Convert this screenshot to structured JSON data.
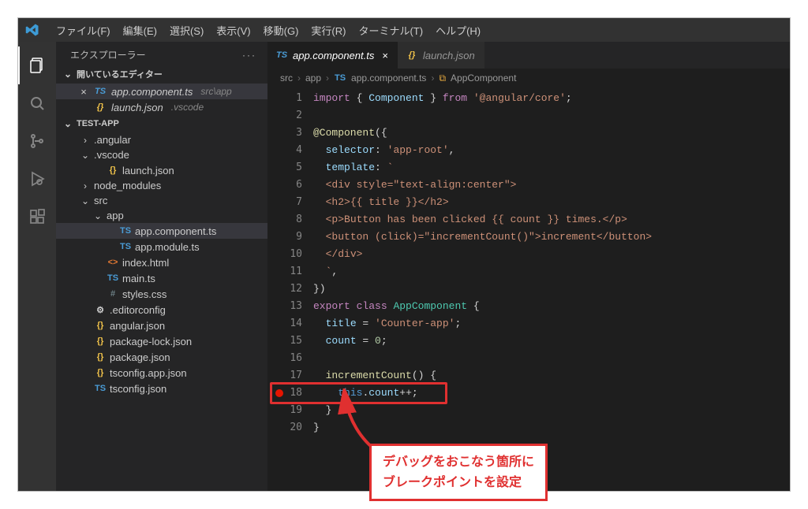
{
  "menubar": {
    "items": [
      "ファイル(F)",
      "編集(E)",
      "選択(S)",
      "表示(V)",
      "移動(G)",
      "実行(R)",
      "ターミナル(T)",
      "ヘルプ(H)"
    ]
  },
  "sidebar": {
    "title": "エクスプローラー",
    "open_editors_label": "開いているエディター",
    "open_editors": [
      {
        "name": "app.component.ts",
        "icon": "TS",
        "path": "src\\app",
        "active": true,
        "close": true
      },
      {
        "name": "launch.json",
        "icon": "{}",
        "path": ".vscode",
        "active": false,
        "close": false
      }
    ],
    "project": "TEST-APP",
    "tree": [
      {
        "type": "folder",
        "name": ".angular",
        "expanded": false,
        "indent": 1
      },
      {
        "type": "folder",
        "name": ".vscode",
        "expanded": true,
        "indent": 1
      },
      {
        "type": "file",
        "name": "launch.json",
        "icon": "{}",
        "iconClass": "icon-json",
        "indent": 2
      },
      {
        "type": "folder",
        "name": "node_modules",
        "expanded": false,
        "indent": 1
      },
      {
        "type": "folder",
        "name": "src",
        "expanded": true,
        "indent": 1
      },
      {
        "type": "folder",
        "name": "app",
        "expanded": true,
        "indent": 2
      },
      {
        "type": "file",
        "name": "app.component.ts",
        "icon": "TS",
        "iconClass": "icon-ts",
        "indent": 3,
        "selected": true
      },
      {
        "type": "file",
        "name": "app.module.ts",
        "icon": "TS",
        "iconClass": "icon-ts",
        "indent": 3
      },
      {
        "type": "file",
        "name": "index.html",
        "icon": "<>",
        "iconClass": "icon-html",
        "indent": 2
      },
      {
        "type": "file",
        "name": "main.ts",
        "icon": "TS",
        "iconClass": "icon-ts",
        "indent": 2
      },
      {
        "type": "file",
        "name": "styles.css",
        "icon": "#",
        "iconClass": "icon-css",
        "indent": 2
      },
      {
        "type": "file",
        "name": ".editorconfig",
        "icon": "⚙",
        "iconClass": "",
        "indent": 1
      },
      {
        "type": "file",
        "name": "angular.json",
        "icon": "{}",
        "iconClass": "icon-json",
        "indent": 1
      },
      {
        "type": "file",
        "name": "package-lock.json",
        "icon": "{}",
        "iconClass": "icon-json",
        "indent": 1
      },
      {
        "type": "file",
        "name": "package.json",
        "icon": "{}",
        "iconClass": "icon-json",
        "indent": 1
      },
      {
        "type": "file",
        "name": "tsconfig.app.json",
        "icon": "{}",
        "iconClass": "icon-json",
        "indent": 1
      },
      {
        "type": "file",
        "name": "tsconfig.json",
        "icon": "TS",
        "iconClass": "icon-ts",
        "indent": 1
      }
    ]
  },
  "tabs": [
    {
      "name": "app.component.ts",
      "icon": "TS",
      "active": true,
      "close": true
    },
    {
      "name": "launch.json",
      "icon": "{}",
      "active": false,
      "close": false
    }
  ],
  "breadcrumbs": {
    "parts": [
      "src",
      "app",
      "app.component.ts",
      "AppComponent"
    ],
    "file_icon": "TS",
    "struct_icon": "struct"
  },
  "code": {
    "lines": [
      1,
      2,
      3,
      4,
      5,
      6,
      7,
      8,
      9,
      10,
      11,
      12,
      13,
      14,
      15,
      16,
      17,
      18,
      19,
      20
    ],
    "breakpoint_line": 18,
    "content": {
      "l1": {
        "pre": "",
        "tokens": [
          [
            "tk-kw",
            "import"
          ],
          [
            "tk-punc",
            " { "
          ],
          [
            "tk-var",
            "Component"
          ],
          [
            "tk-punc",
            " } "
          ],
          [
            "tk-kw",
            "from"
          ],
          [
            "tk-punc",
            " "
          ],
          [
            "tk-str",
            "'@angular/core'"
          ],
          [
            "tk-punc",
            ";"
          ]
        ]
      },
      "l2": {
        "pre": "",
        "tokens": []
      },
      "l3": {
        "pre": "",
        "tokens": [
          [
            "tk-dec",
            "@Component"
          ],
          [
            "tk-punc",
            "({"
          ]
        ]
      },
      "l4": {
        "pre": "  ",
        "tokens": [
          [
            "tk-attr",
            "selector"
          ],
          [
            "tk-punc",
            ": "
          ],
          [
            "tk-str",
            "'app-root'"
          ],
          [
            "tk-punc",
            ","
          ]
        ]
      },
      "l5": {
        "pre": "  ",
        "tokens": [
          [
            "tk-attr",
            "template"
          ],
          [
            "tk-punc",
            ": "
          ],
          [
            "tk-str",
            "`"
          ]
        ]
      },
      "l6": {
        "pre": "  ",
        "tokens": [
          [
            "tk-str",
            "<div style=\"text-align:center\">"
          ]
        ]
      },
      "l7": {
        "pre": "  ",
        "tokens": [
          [
            "tk-str",
            "<h2>{{ title }}</h2>"
          ]
        ]
      },
      "l8": {
        "pre": "  ",
        "tokens": [
          [
            "tk-str",
            "<p>Button has been clicked {{ count }} times.</p>"
          ]
        ]
      },
      "l9": {
        "pre": "  ",
        "tokens": [
          [
            "tk-str",
            "<button (click)=\"incrementCount()\">increment</button>"
          ]
        ]
      },
      "l10": {
        "pre": "  ",
        "tokens": [
          [
            "tk-str",
            "</div>"
          ]
        ]
      },
      "l11": {
        "pre": "  ",
        "tokens": [
          [
            "tk-str",
            "`"
          ],
          [
            "tk-punc",
            ","
          ]
        ]
      },
      "l12": {
        "pre": "",
        "tokens": [
          [
            "tk-punc",
            "})"
          ]
        ]
      },
      "l13": {
        "pre": "",
        "tokens": [
          [
            "tk-kw",
            "export"
          ],
          [
            "tk-punc",
            " "
          ],
          [
            "tk-kw",
            "class"
          ],
          [
            "tk-punc",
            " "
          ],
          [
            "tk-type",
            "AppComponent"
          ],
          [
            "tk-punc",
            " {"
          ]
        ]
      },
      "l14": {
        "pre": "  ",
        "tokens": [
          [
            "tk-attr",
            "title"
          ],
          [
            "tk-punc",
            " = "
          ],
          [
            "tk-str",
            "'Counter-app'"
          ],
          [
            "tk-punc",
            ";"
          ]
        ]
      },
      "l15": {
        "pre": "  ",
        "tokens": [
          [
            "tk-attr",
            "count"
          ],
          [
            "tk-punc",
            " = "
          ],
          [
            "tk-num",
            "0"
          ],
          [
            "tk-punc",
            ";"
          ]
        ]
      },
      "l16": {
        "pre": "",
        "tokens": []
      },
      "l17": {
        "pre": "  ",
        "tokens": [
          [
            "tk-dec",
            "incrementCount"
          ],
          [
            "tk-punc",
            "() {"
          ]
        ]
      },
      "l18": {
        "pre": "    ",
        "tokens": [
          [
            "tk-id",
            "this"
          ],
          [
            "tk-punc",
            "."
          ],
          [
            "tk-attr",
            "count"
          ],
          [
            "tk-punc",
            "++;"
          ]
        ]
      },
      "l19": {
        "pre": "  ",
        "tokens": [
          [
            "tk-punc",
            "}"
          ]
        ]
      },
      "l20": {
        "pre": "",
        "tokens": [
          [
            "tk-punc",
            "}"
          ]
        ]
      }
    }
  },
  "annot": {
    "line1": "デバッグをおこなう箇所に",
    "line2": "ブレークポイントを設定"
  }
}
